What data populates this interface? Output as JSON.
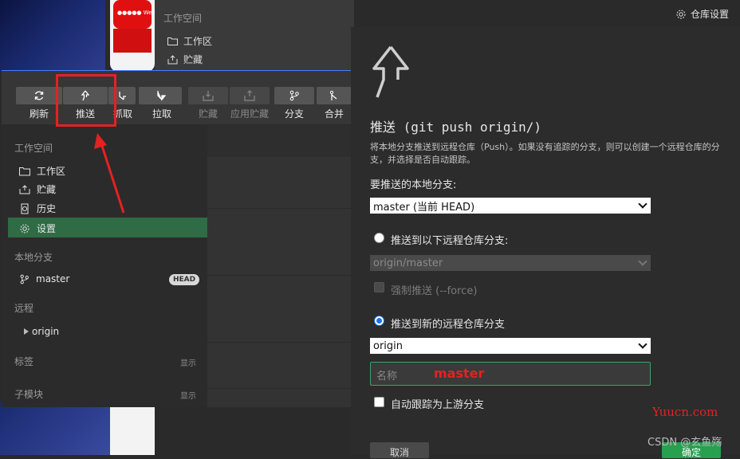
{
  "background": {
    "phone_banner": "●●●●● WeC",
    "workspace_header": "工作空间",
    "workspace_items": [
      "工作区",
      "贮藏"
    ],
    "repo_settings": "仓库设置"
  },
  "toolbar": {
    "buttons": [
      {
        "label": "刷新",
        "icon": "refresh-icon",
        "enabled": true
      },
      {
        "label": "推送",
        "icon": "push-icon",
        "enabled": true
      },
      {
        "label": "抓取",
        "icon": "fetch-icon",
        "enabled": true
      },
      {
        "label": "拉取",
        "icon": "pull-icon",
        "enabled": true
      },
      {
        "label": "贮藏",
        "icon": "stash-icon",
        "enabled": false
      },
      {
        "label": "应用贮藏",
        "icon": "apply-stash-icon",
        "enabled": false
      },
      {
        "label": "分支",
        "icon": "branch-icon",
        "enabled": true
      },
      {
        "label": "合并",
        "icon": "merge-icon",
        "enabled": true
      }
    ]
  },
  "sidebar": {
    "workspace_header": "工作空间",
    "workspace_items": [
      {
        "label": "工作区",
        "icon": "folder-icon"
      },
      {
        "label": "贮藏",
        "icon": "stash-icon"
      },
      {
        "label": "历史",
        "icon": "history-icon"
      },
      {
        "label": "设置",
        "icon": "gear-icon",
        "selected": true
      }
    ],
    "local_branches_header": "本地分支",
    "local_branch": "master",
    "head_badge": "HEAD",
    "remotes_header": "远程",
    "remote": "origin",
    "tags_header": "标签",
    "tags_show": "显示",
    "submodules_header": "子模块",
    "submodules_show": "显示"
  },
  "dialog": {
    "title": "推送 (git push origin/)",
    "description": "将本地分支推送到远程仓库（Push）。如果没有追踪的分支，则可以创建一个远程仓库的分支，并选择是否自动跟踪。",
    "local_branch_label": "要推送的本地分支:",
    "local_branch_value": "master (当前 HEAD)",
    "radio_existing_label": "推送到以下远程仓库分支:",
    "existing_remote_value": "origin/master",
    "force_label": "强制推送 (--force)",
    "radio_new_label": "推送到新的远程仓库分支",
    "new_remote_value": "origin",
    "name_placeholder": "名称",
    "name_value": "master",
    "track_label": "自动跟踪为上游分支",
    "cancel_label": "取消",
    "ok_label": "确定"
  },
  "watermarks": {
    "site": "Yuucn.com",
    "csdn": "CSDN @玄鱼殇"
  },
  "colors": {
    "accent_green": "#27a050",
    "selected_row": "#2f6b44",
    "annotation_red": "#e32222",
    "radio_blue": "#1a73e8"
  }
}
